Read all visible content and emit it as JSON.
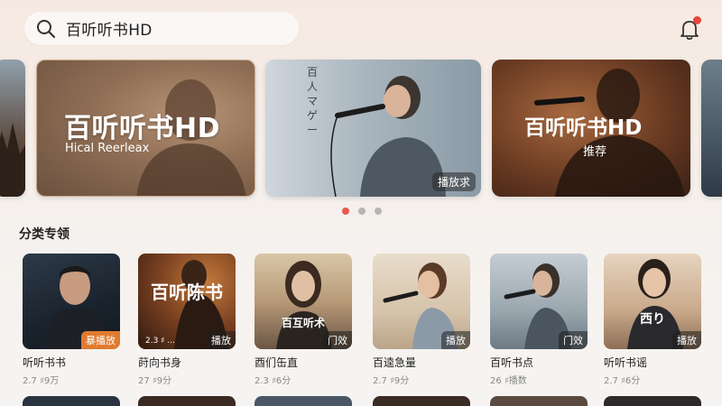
{
  "search": {
    "query": "百听听书HD"
  },
  "banners": [
    {
      "title": "百听听书HD",
      "subtitle": "Hical Reerleax"
    },
    {
      "sign": "百 人 マ ゲ ー",
      "badge": "播放求"
    },
    {
      "title": "百听听书HD",
      "subtitle": "推荐"
    }
  ],
  "section": {
    "title": "分类专领"
  },
  "cards": [
    {
      "name": "听听书书",
      "meta": "2.7 ♯9万",
      "tag": "暴播放",
      "thumb_text": ""
    },
    {
      "name": "莳向书身",
      "meta": "27 ♯9分",
      "tag": "播放",
      "thumb_text": "百听陈书",
      "thumb_small": "2.3 ♯ ..."
    },
    {
      "name": "酉们缶直",
      "meta": "2.3 ♯6分",
      "tag": "门效",
      "thumb_text": "百互听术"
    },
    {
      "name": "百逵急量",
      "meta": "2.7 ♯9分",
      "tag": "播放",
      "thumb_text": ""
    },
    {
      "name": "百听书点",
      "meta": "26 ♯播数",
      "tag": "门效",
      "thumb_text": ""
    },
    {
      "name": "听听书谣",
      "meta": "2.7 ♯6分",
      "tag": "播放",
      "thumb_text": "西り"
    }
  ],
  "colors": {
    "accent": "#e8453c",
    "dot_active": "#e8594c",
    "tag_orange": "#e07a2f"
  },
  "icons": {
    "search": "search-icon",
    "bell": "bell-icon"
  }
}
